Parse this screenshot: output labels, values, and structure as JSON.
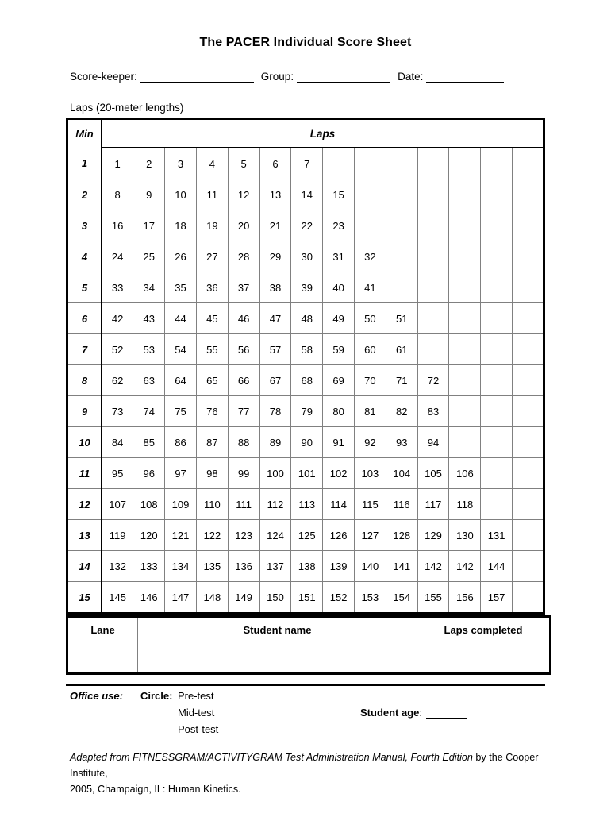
{
  "document": {
    "title": "The PACER Individual Score Sheet"
  },
  "header_fields": {
    "scorekeeper_label": "Score-keeper:",
    "group_label": "Group:",
    "date_label": "Date:",
    "scorekeeper_value": "",
    "group_value": "",
    "date_value": ""
  },
  "laps_caption": "Laps (20-meter lengths)",
  "pacer_table": {
    "min_header": "Min",
    "laps_header": "Laps",
    "lap_column_count": 14,
    "rows": [
      {
        "min": "1",
        "laps": [
          "1",
          "2",
          "3",
          "4",
          "5",
          "6",
          "7"
        ]
      },
      {
        "min": "2",
        "laps": [
          "8",
          "9",
          "10",
          "11",
          "12",
          "13",
          "14",
          "15"
        ]
      },
      {
        "min": "3",
        "laps": [
          "16",
          "17",
          "18",
          "19",
          "20",
          "21",
          "22",
          "23"
        ]
      },
      {
        "min": "4",
        "laps": [
          "24",
          "25",
          "26",
          "27",
          "28",
          "29",
          "30",
          "31",
          "32"
        ]
      },
      {
        "min": "5",
        "laps": [
          "33",
          "34",
          "35",
          "36",
          "37",
          "38",
          "39",
          "40",
          "41"
        ]
      },
      {
        "min": "6",
        "laps": [
          "42",
          "43",
          "44",
          "45",
          "46",
          "47",
          "48",
          "49",
          "50",
          "51"
        ]
      },
      {
        "min": "7",
        "laps": [
          "52",
          "53",
          "54",
          "55",
          "56",
          "57",
          "58",
          "59",
          "60",
          "61"
        ]
      },
      {
        "min": "8",
        "laps": [
          "62",
          "63",
          "64",
          "65",
          "66",
          "67",
          "68",
          "69",
          "70",
          "71",
          "72"
        ]
      },
      {
        "min": "9",
        "laps": [
          "73",
          "74",
          "75",
          "76",
          "77",
          "78",
          "79",
          "80",
          "81",
          "82",
          "83"
        ]
      },
      {
        "min": "10",
        "laps": [
          "84",
          "85",
          "86",
          "87",
          "88",
          "89",
          "90",
          "91",
          "92",
          "93",
          "94"
        ]
      },
      {
        "min": "11",
        "laps": [
          "95",
          "96",
          "97",
          "98",
          "99",
          "100",
          "101",
          "102",
          "103",
          "104",
          "105",
          "106"
        ]
      },
      {
        "min": "12",
        "laps": [
          "107",
          "108",
          "109",
          "110",
          "111",
          "112",
          "113",
          "114",
          "115",
          "116",
          "117",
          "118"
        ]
      },
      {
        "min": "13",
        "laps": [
          "119",
          "120",
          "121",
          "122",
          "123",
          "124",
          "125",
          "126",
          "127",
          "128",
          "129",
          "130",
          "131"
        ]
      },
      {
        "min": "14",
        "laps": [
          "132",
          "133",
          "134",
          "135",
          "136",
          "137",
          "138",
          "139",
          "140",
          "141",
          "142",
          "142",
          "144"
        ]
      },
      {
        "min": "15",
        "laps": [
          "145",
          "146",
          "147",
          "148",
          "149",
          "150",
          "151",
          "152",
          "153",
          "154",
          "155",
          "156",
          "157"
        ]
      }
    ]
  },
  "roster_table": {
    "headers": [
      "Lane",
      "Student name",
      "Laps completed"
    ],
    "rows": [
      {
        "lane": "",
        "student_name": "",
        "laps_completed": ""
      }
    ]
  },
  "office_use": {
    "office_use_label": "Office use:",
    "circle_label": "Circle:",
    "options": [
      "Pre-test",
      "Mid-test",
      "Post-test"
    ],
    "student_age_label": "Student age",
    "student_age_colon": ":",
    "student_age_value": ""
  },
  "footnote": {
    "italic_part": "Adapted from FITNESSGRAM/ACTIVITYGRAM Test Administration Manual, Fourth Edition",
    "regular_part": " by the Cooper Institute,",
    "line2": "2005, Champaign, IL: Human Kinetics."
  },
  "colors": {
    "text": "#000000",
    "page_background": "#ffffff",
    "grid_line": "#808080",
    "frame_line": "#000000"
  }
}
